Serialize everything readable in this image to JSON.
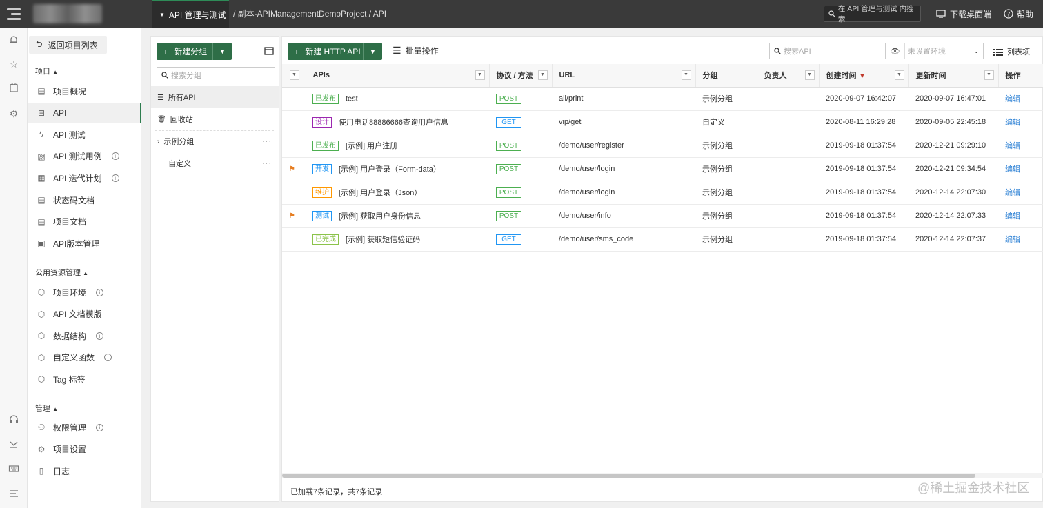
{
  "topbar": {
    "module_label": "API 管理与测试",
    "breadcrumb": "/ 副本-APIManagementDemoProject / API",
    "search_label": "在 API 管理与测试 内搜索",
    "download_label": "下载桌面端",
    "help_label": "帮助"
  },
  "nav": {
    "back_label": "返回项目列表",
    "section_project": "项目",
    "section_public": "公用资源管理",
    "section_manage": "管理",
    "items_project": [
      {
        "label": "项目概况",
        "icon": "overview-icon",
        "info": false
      },
      {
        "label": "API",
        "icon": "api-icon",
        "info": false
      },
      {
        "label": "API 测试",
        "icon": "lightning-icon",
        "info": false
      },
      {
        "label": "API 测试用例",
        "icon": "testcase-icon",
        "info": true
      },
      {
        "label": "API 迭代计划",
        "icon": "plan-icon",
        "info": true
      },
      {
        "label": "状态码文档",
        "icon": "doc-icon",
        "info": false
      },
      {
        "label": "项目文档",
        "icon": "doc-icon",
        "info": false
      },
      {
        "label": "API版本管理",
        "icon": "version-icon",
        "info": false
      }
    ],
    "items_public": [
      {
        "label": "项目环境",
        "icon": "cube-icon",
        "info": true
      },
      {
        "label": "API 文档模版",
        "icon": "cube-icon",
        "info": false
      },
      {
        "label": "数据结构",
        "icon": "cube-icon",
        "info": true
      },
      {
        "label": "自定义函数",
        "icon": "cube-icon",
        "info": true
      },
      {
        "label": "Tag 标签",
        "icon": "cube-icon",
        "info": false
      }
    ],
    "items_manage": [
      {
        "label": "权限管理",
        "icon": "user-icon",
        "info": true
      },
      {
        "label": "项目设置",
        "icon": "gear-icon",
        "info": false
      },
      {
        "label": "日志",
        "icon": "log-icon",
        "info": false
      }
    ]
  },
  "groups": {
    "new_group_label": "新建分组",
    "search_placeholder": "搜索分组",
    "items": [
      "所有API",
      "回收站",
      "示例分组",
      "自定义"
    ]
  },
  "main": {
    "new_api_label": "新建 HTTP API",
    "batch_label": "批量操作",
    "search_placeholder": "搜索API",
    "env_placeholder": "未设置环境",
    "list_view_label": "列表项",
    "columns": [
      "APIs",
      "协议 / 方法",
      "URL",
      "分组",
      "负责人",
      "创建时间",
      "更新时间",
      "操作"
    ],
    "rows": [
      {
        "flag": false,
        "status": "已发布",
        "status_color": "#4caf50",
        "name": "test",
        "method": "POST",
        "method_color": "#4caf50",
        "url": "all/print",
        "group": "示例分组",
        "owner": "",
        "created": "2020-09-07 16:42:07",
        "updated": "2020-09-07 16:47:01",
        "action": "编辑"
      },
      {
        "flag": false,
        "status": "设计",
        "status_color": "#9c27b0",
        "name": "使用电话88886666查询用户信息",
        "method": "GET",
        "method_color": "#2196f3",
        "url": "vip/get",
        "group": "自定义",
        "owner": "",
        "created": "2020-08-11 16:29:28",
        "updated": "2020-09-05 22:45:18",
        "action": "编辑"
      },
      {
        "flag": false,
        "status": "已发布",
        "status_color": "#4caf50",
        "name": "[示例] 用户注册",
        "method": "POST",
        "method_color": "#4caf50",
        "url": "/demo/user/register",
        "group": "示例分组",
        "owner": "",
        "created": "2019-09-18 01:37:54",
        "updated": "2020-12-21 09:29:10",
        "action": "编辑"
      },
      {
        "flag": true,
        "status": "开发",
        "status_color": "#2196f3",
        "name": "[示例] 用户登录（Form-data）",
        "method": "POST",
        "method_color": "#4caf50",
        "url": "/demo/user/login",
        "group": "示例分组",
        "owner": "",
        "created": "2019-09-18 01:37:54",
        "updated": "2020-12-21 09:34:54",
        "action": "编辑"
      },
      {
        "flag": false,
        "status": "维护",
        "status_color": "#ff9800",
        "name": "[示例] 用户登录（Json）",
        "method": "POST",
        "method_color": "#4caf50",
        "url": "/demo/user/login",
        "group": "示例分组",
        "owner": "",
        "created": "2019-09-18 01:37:54",
        "updated": "2020-12-14 22:07:30",
        "action": "编辑"
      },
      {
        "flag": true,
        "status": "测试",
        "status_color": "#2196f3",
        "name": "[示例] 获取用户身份信息",
        "method": "POST",
        "method_color": "#4caf50",
        "url": "/demo/user/info",
        "group": "示例分组",
        "owner": "",
        "created": "2019-09-18 01:37:54",
        "updated": "2020-12-14 22:07:33",
        "action": "编辑"
      },
      {
        "flag": false,
        "status": "已完成",
        "status_color": "#8bc34a",
        "name": "[示例] 获取短信验证码",
        "method": "GET",
        "method_color": "#2196f3",
        "url": "/demo/user/sms_code",
        "group": "示例分组",
        "owner": "",
        "created": "2019-09-18 01:37:54",
        "updated": "2020-12-14 22:07:37",
        "action": "编辑"
      }
    ],
    "footer": "已加载7条记录，共7条记录"
  },
  "watermark": "@稀土掘金技术社区"
}
